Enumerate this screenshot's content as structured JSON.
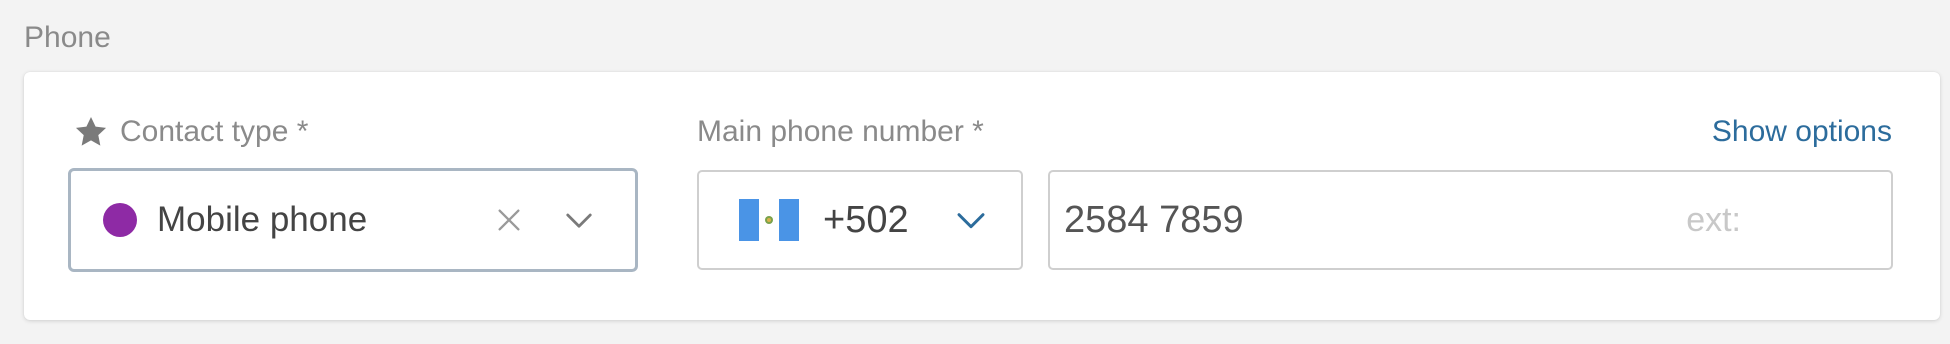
{
  "section": {
    "label": "Phone"
  },
  "contact_type": {
    "label": "Contact type *",
    "icon": "star-icon",
    "value": "Mobile phone",
    "dot_color": "#8e2aa5",
    "clear_icon": "close-icon",
    "dropdown_icon": "chevron-down-icon"
  },
  "main_phone": {
    "label": "Main phone number *",
    "show_options_label": "Show options",
    "country_flag": "guatemala-flag-icon",
    "country_code": "+502",
    "number": "2584 7859",
    "ext_placeholder": "ext:"
  },
  "colors": {
    "link": "#2c6c9c",
    "label": "#8a8a8a",
    "active_border": "#a9b6c3",
    "chevron_accent": "#2c6c9c"
  }
}
